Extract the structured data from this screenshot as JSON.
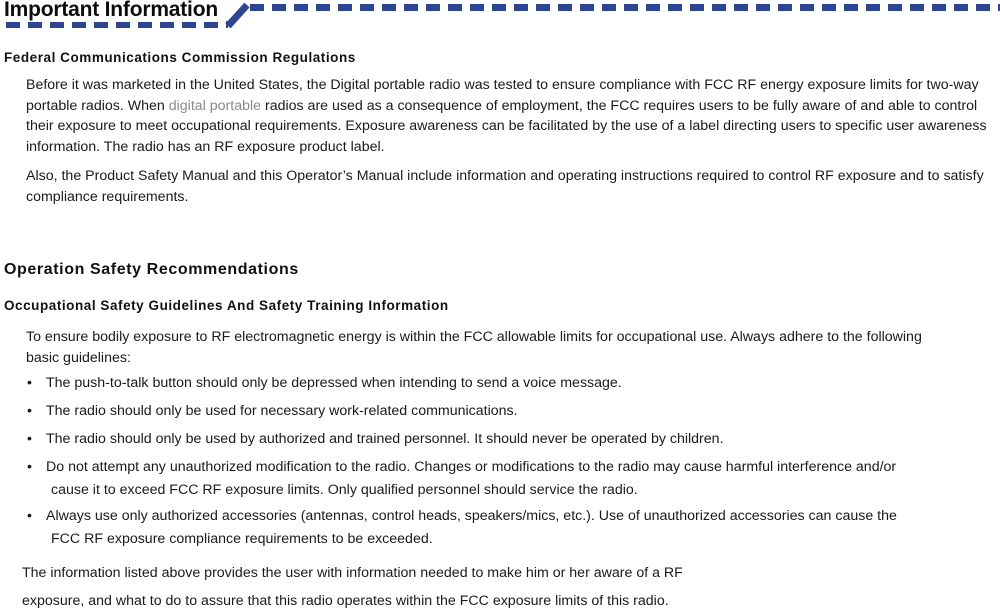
{
  "header": {
    "title": "Important Information",
    "rule_color": "#2E4593"
  },
  "sections": {
    "fcc": {
      "heading": "Federal Communications Commission Regulations",
      "paragraph_1": {
        "before_gray": "Before it was marketed in the United States, the Digital portable radio was tested to ensure compliance with FCC RF energy exposure limits for two-way portable radios. When ",
        "gray_run": "digital portable",
        "after_gray": " radios are used as a consequence of employment, the FCC requires users to be fully aware of and able to control their exposure to meet occupational requirements. Exposure awareness can be facilitated by the use of a label directing users to specific user awareness information. The radio has an RF exposure product label."
      },
      "paragraph_2": "Also, the Product Safety Manual and this Operator’s Manual include information and operating instructions required to control RF exposure and to satisfy compliance requirements."
    },
    "operation_safety": {
      "heading": "Operation Safety Recommendations",
      "subheading": "Occupational Safety Guidelines And Safety Training Information",
      "intro": "To ensure bodily exposure to RF electromagnetic energy is within the FCC allowable limits for occupational use. Always adhere to the following basic guidelines:",
      "bullet_symbol": "•",
      "bullets": [
        {
          "text": "The push-to-talk button should only be depressed when intending to send a voice message.",
          "continuation": ""
        },
        {
          "text": "The radio should only be used for necessary work-related communications.",
          "continuation": ""
        },
        {
          "text": "The radio should only be used by authorized and trained personnel. It should never be operated by children.",
          "continuation": ""
        },
        {
          "text": "Do not attempt any unauthorized modification to the radio. Changes or modifications to the radio may cause harmful interference and/or",
          "continuation": "cause it to exceed FCC RF exposure limits. Only qualified personnel should service the radio."
        },
        {
          "text": "Always use only authorized accessories (antennas, control heads, speakers/mics, etc.). Use of unauthorized accessories can cause the",
          "continuation": "FCC RF exposure compliance requirements to be exceeded."
        }
      ],
      "closing_line_1": "The information listed above provides the user with information needed to make him or her aware of a RF",
      "closing_line_2": "exposure, and what to do to assure that this radio operates within the FCC exposure limits of this radio."
    }
  }
}
